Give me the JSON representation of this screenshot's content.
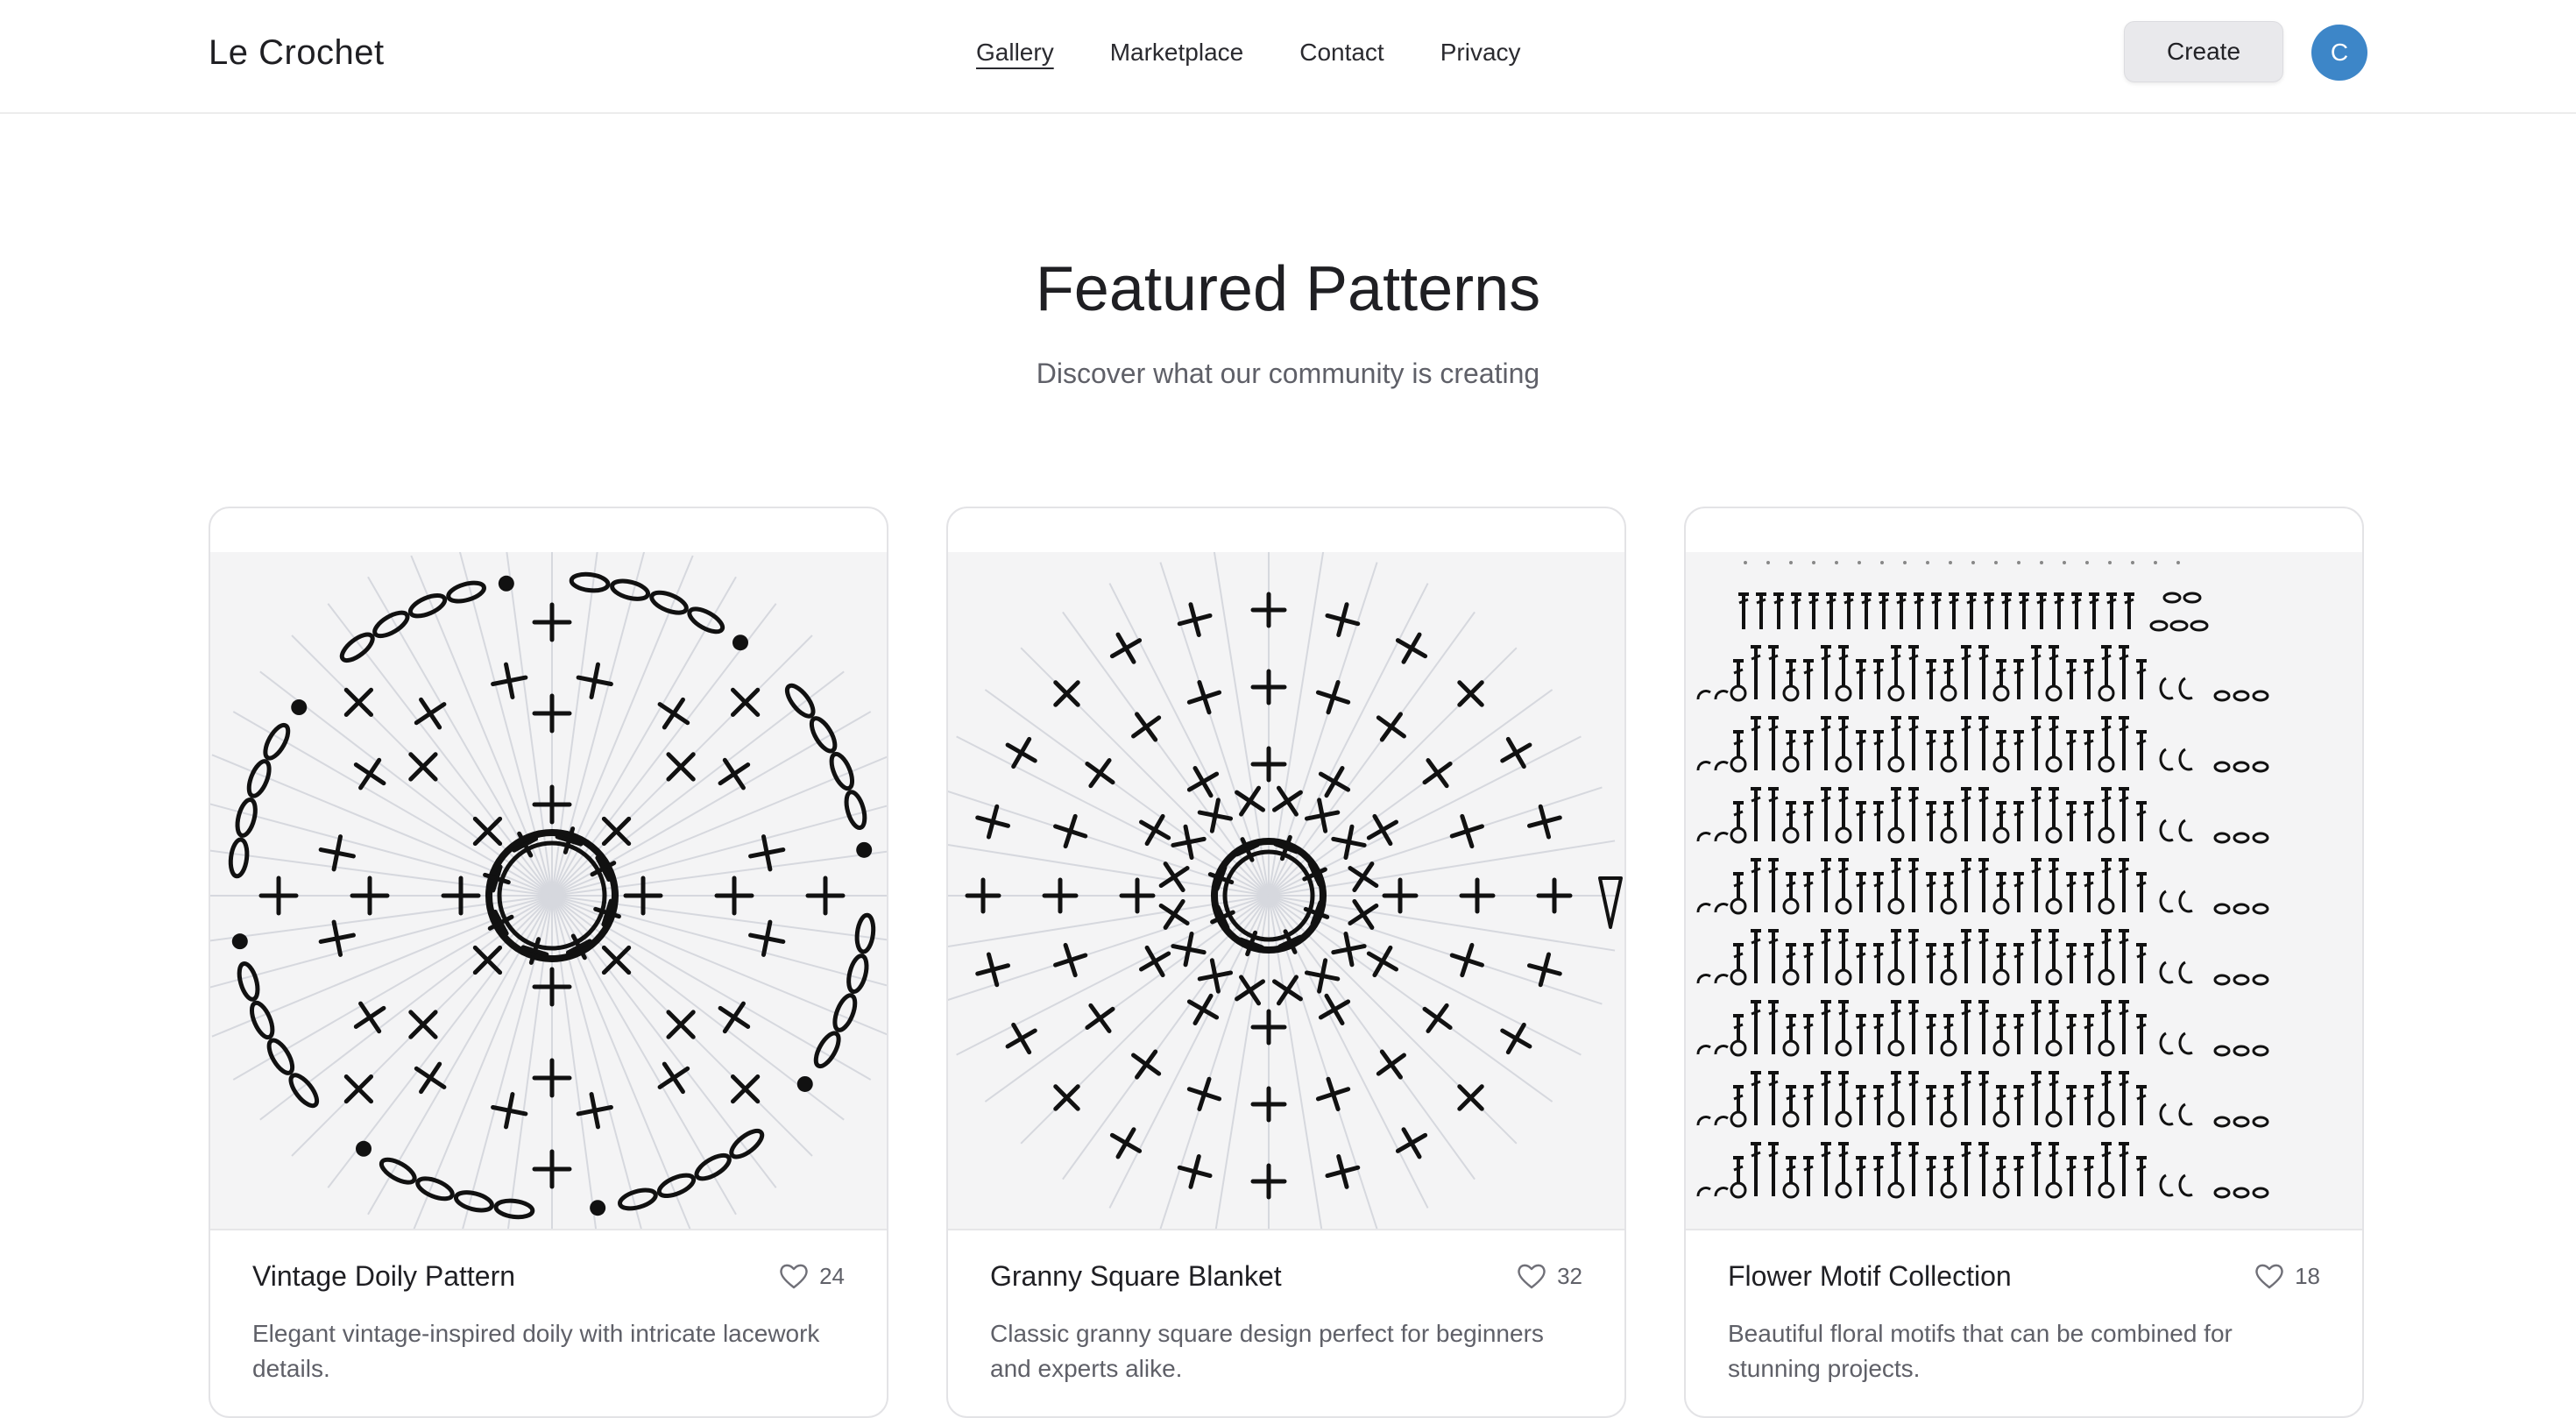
{
  "header": {
    "brand": "Le Crochet",
    "nav": [
      {
        "label": "Gallery",
        "active": true
      },
      {
        "label": "Marketplace",
        "active": false
      },
      {
        "label": "Contact",
        "active": false
      },
      {
        "label": "Privacy",
        "active": false
      }
    ],
    "create_label": "Create",
    "avatar_initial": "C",
    "avatar_color": "#3d86c8"
  },
  "hero": {
    "title": "Featured Patterns",
    "subtitle": "Discover what our community is creating"
  },
  "cards": [
    {
      "title": "Vintage Doily Pattern",
      "likes": "24",
      "description": "Elegant vintage-inspired doily with intricate lacework details.",
      "image_icon": "doily-chart-icon"
    },
    {
      "title": "Granny Square Blanket",
      "likes": "32",
      "description": "Classic granny square design perfect for beginners and experts alike.",
      "image_icon": "granny-square-chart-icon"
    },
    {
      "title": "Flower Motif Collection",
      "likes": "18",
      "description": "Beautiful floral motifs that can be combined for stunning projects.",
      "image_icon": "flower-motif-chart-icon"
    }
  ]
}
